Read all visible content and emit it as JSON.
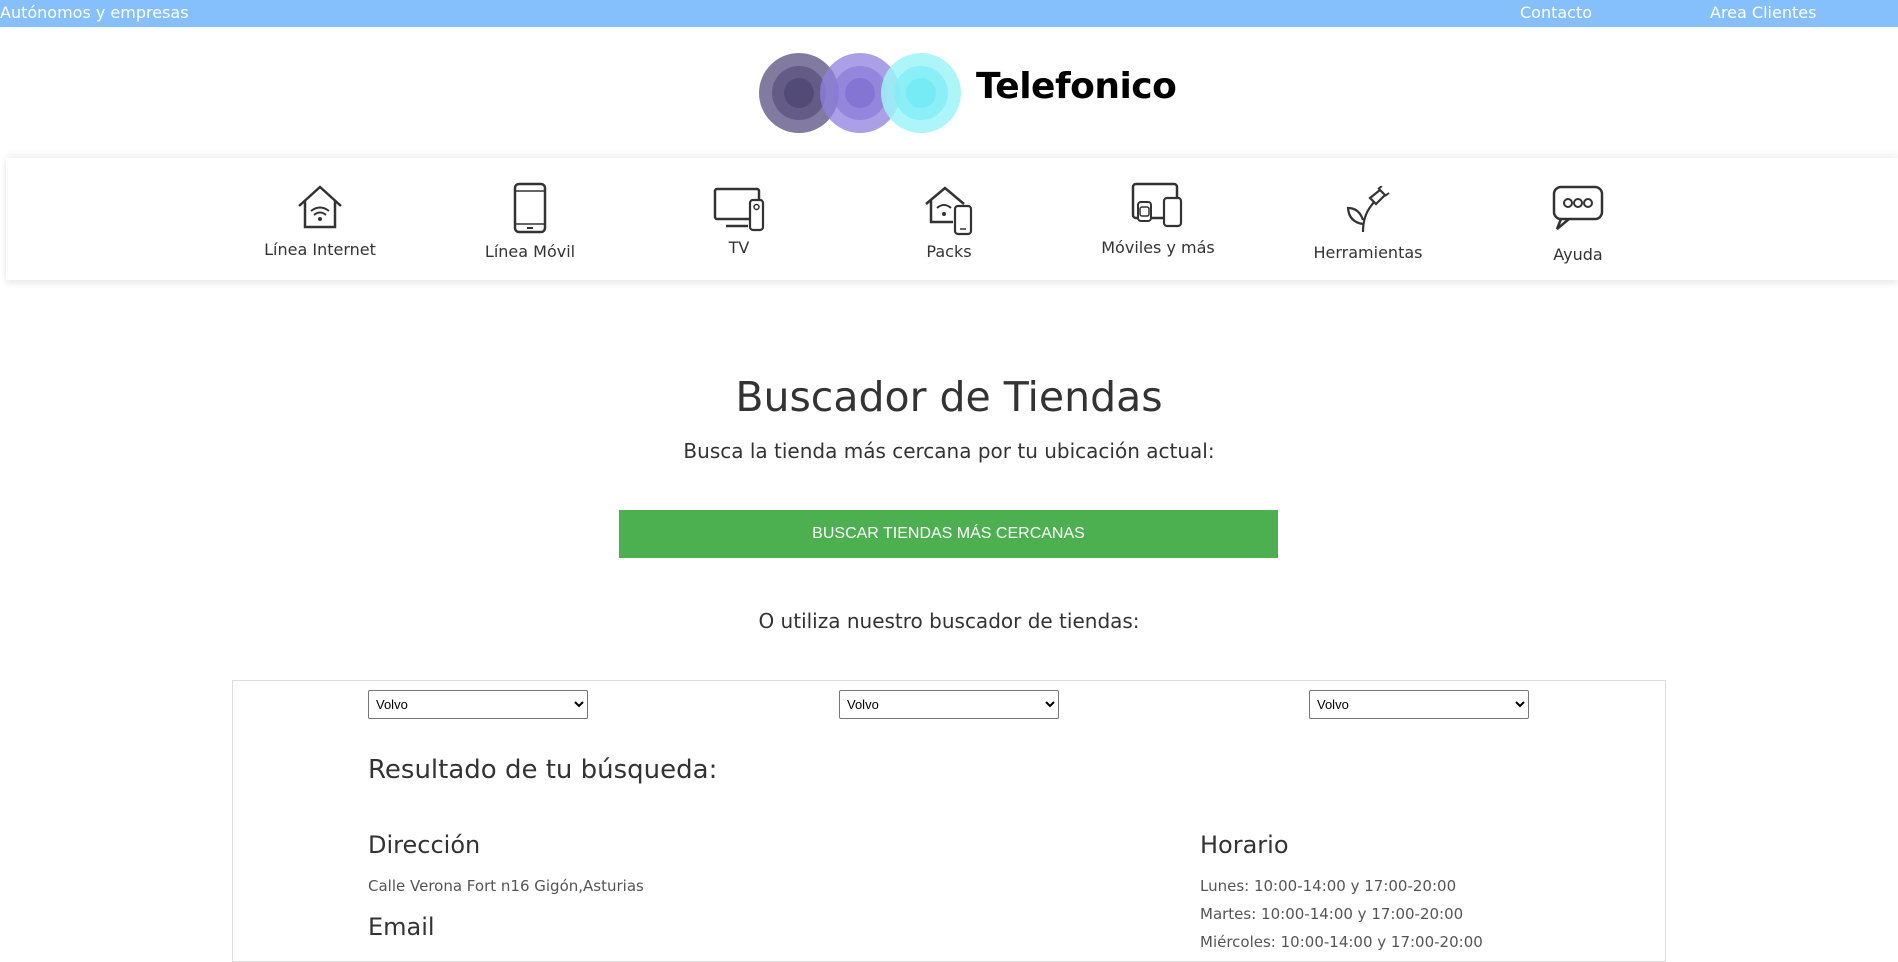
{
  "topbar": {
    "left_link": "Autónomos y empresas",
    "contact": "Contacto",
    "area_clientes": "Area Clientes",
    "bg_color": "#85c0fc"
  },
  "logo": {
    "text": "Telefonico"
  },
  "nav": {
    "items": [
      {
        "label": "Línea Internet",
        "icon": "house-wifi-icon"
      },
      {
        "label": "Línea Móvil",
        "icon": "smartphone-icon"
      },
      {
        "label": "TV",
        "icon": "tv-remote-icon"
      },
      {
        "label": "Packs",
        "icon": "house-phone-icon"
      },
      {
        "label": "Móviles y más",
        "icon": "devices-icon"
      },
      {
        "label": "Herramientas",
        "icon": "plant-plug-icon"
      },
      {
        "label": "Ayuda",
        "icon": "chat-bubble-icon"
      }
    ]
  },
  "hero": {
    "title": "Buscador de Tiendas",
    "subtitle": "Busca la tienda más cercana por tu ubicación actual:",
    "button_label": "BUSCAR TIENDAS MÁS CERCANAS",
    "button_color": "#4caf50",
    "alt_text": "O utiliza nuestro buscador de tiendas:"
  },
  "search": {
    "selects": [
      {
        "value": "Volvo"
      },
      {
        "value": "Volvo"
      },
      {
        "value": "Volvo"
      }
    ]
  },
  "results": {
    "title": "Resultado de tu búsqueda:",
    "address_heading": "Dirección",
    "address": "Calle Verona Fort n16 Gigón,Asturias",
    "email_heading": "Email",
    "hours_heading": "Horario",
    "hours": [
      "Lunes: 10:00-14:00 y 17:00-20:00",
      "Martes: 10:00-14:00 y 17:00-20:00",
      "Miércoles: 10:00-14:00 y 17:00-20:00"
    ]
  }
}
